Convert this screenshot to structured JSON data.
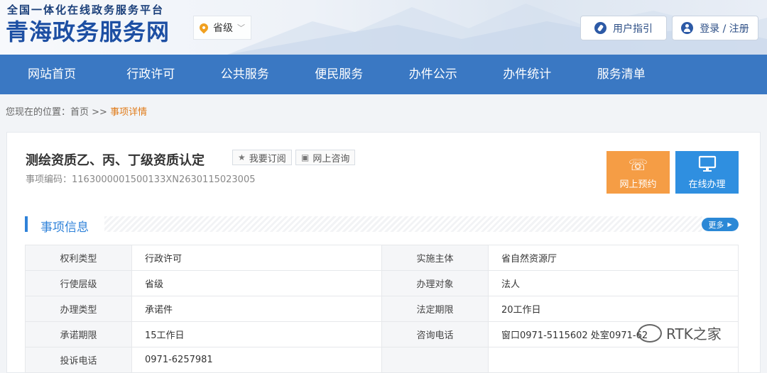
{
  "header": {
    "logo_top": "全国一体化在线政务服务平台",
    "logo_main": "青海政务服务网",
    "region": "省级",
    "guide_button": "用户指引",
    "login_button": "登录 / 注册"
  },
  "nav": {
    "items": [
      "网站首页",
      "行政许可",
      "公共服务",
      "便民服务",
      "办件公示",
      "办件统计",
      "服务清单"
    ]
  },
  "breadcrumb": {
    "prefix": "您现在的位置：首页 >>",
    "current": "事项详情"
  },
  "item": {
    "title": "测绘资质乙、丙、丁级资质认定",
    "subscribe": "我要订阅",
    "consult": "网上咨询",
    "code": "事项编码：1163000001500133XN2630115023005",
    "appoint_button": "网上预约",
    "online_button": "在线办理"
  },
  "section": {
    "title": "事项信息",
    "more": "更多"
  },
  "info_table": [
    [
      "权利类型",
      "行政许可",
      "实施主体",
      "省自然资源厅"
    ],
    [
      "行使层级",
      "省级",
      "办理对象",
      "法人"
    ],
    [
      "办理类型",
      "承诺件",
      "法定期限",
      "20工作日"
    ],
    [
      "承诺期限",
      "15工作日",
      "咨询电话",
      "窗口0971-5115602 处室0971-62"
    ],
    [
      "投诉电话",
      "0971-6257981",
      "",
      ""
    ]
  ],
  "watermark": "RTK之家",
  "colors": {
    "nav_bg": "#3a78c3",
    "accent_blue": "#2f82d9",
    "orange": "#f59d45",
    "breadcrumb_current": "#e07b1a"
  }
}
